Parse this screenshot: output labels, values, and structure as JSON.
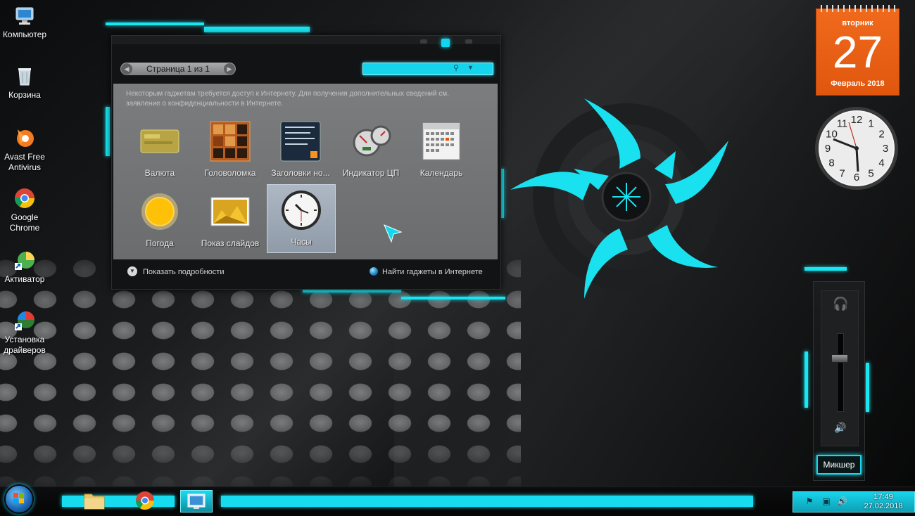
{
  "desktop": {
    "icons": [
      {
        "label": "Компьютер",
        "icon": "computer-icon"
      },
      {
        "label": "Корзина",
        "icon": "recycle-bin-icon"
      },
      {
        "label": "Avast Free Antivirus",
        "icon": "avast-icon"
      },
      {
        "label": "Google Chrome",
        "icon": "chrome-icon"
      },
      {
        "label": "Активатор",
        "icon": "activator-icon"
      },
      {
        "label": "Установка драйверов",
        "icon": "driver-install-icon"
      }
    ]
  },
  "gadget_window": {
    "pager": {
      "label": "Страница 1 из 1",
      "prev_icon": "chevron-left-icon",
      "next_icon": "chevron-right-icon"
    },
    "search": {
      "placeholder": "",
      "icon": "search-icon",
      "dropdown_icon": "chevron-down-icon"
    },
    "notice": "Некоторым гаджетам требуется доступ к Интернету. Для получения дополнительных сведений см. заявление о конфиденциальности в Интернете.",
    "gadgets": [
      {
        "label": "Валюта",
        "icon": "currency-icon",
        "selected": false
      },
      {
        "label": "Головоломка",
        "icon": "puzzle-icon",
        "selected": false
      },
      {
        "label": "Заголовки но...",
        "icon": "news-feed-icon",
        "selected": false
      },
      {
        "label": "Индикатор ЦП",
        "icon": "cpu-meter-icon",
        "selected": false
      },
      {
        "label": "Календарь",
        "icon": "calendar-icon",
        "selected": false
      },
      {
        "label": "Погода",
        "icon": "weather-sun-icon",
        "selected": false
      },
      {
        "label": "Показ слайдов",
        "icon": "slideshow-icon",
        "selected": false
      },
      {
        "label": "Часы",
        "icon": "clock-icon",
        "selected": true
      }
    ],
    "show_details": "Показать подробности",
    "find_online": "Найти гаджеты в Интернете"
  },
  "calendar_gadget": {
    "weekday": "вторник",
    "day": "27",
    "month_year": "Февраль 2018",
    "color": "#e85f14"
  },
  "clock_gadget": {
    "numerals": [
      "12",
      "1",
      "2",
      "3",
      "4",
      "5",
      "6",
      "7",
      "8",
      "9",
      "10",
      "11"
    ],
    "time": "17:49"
  },
  "mixer_gadget": {
    "label": "Микшер",
    "device_icon": "headphones-icon",
    "speaker_icon": "speaker-icon"
  },
  "taskbar": {
    "start_icon": "windows-start-icon",
    "apps": [
      {
        "icon": "folder-icon",
        "active": false
      },
      {
        "icon": "chrome-icon",
        "active": false
      },
      {
        "icon": "gadgets-icon",
        "active": true
      }
    ],
    "tray": {
      "icons": [
        "flag-icon",
        "network-icon",
        "volume-icon"
      ],
      "time": "17:49",
      "date": "27.02.2018"
    }
  },
  "colors": {
    "accent": "#18e7f2",
    "background": "#050607"
  }
}
